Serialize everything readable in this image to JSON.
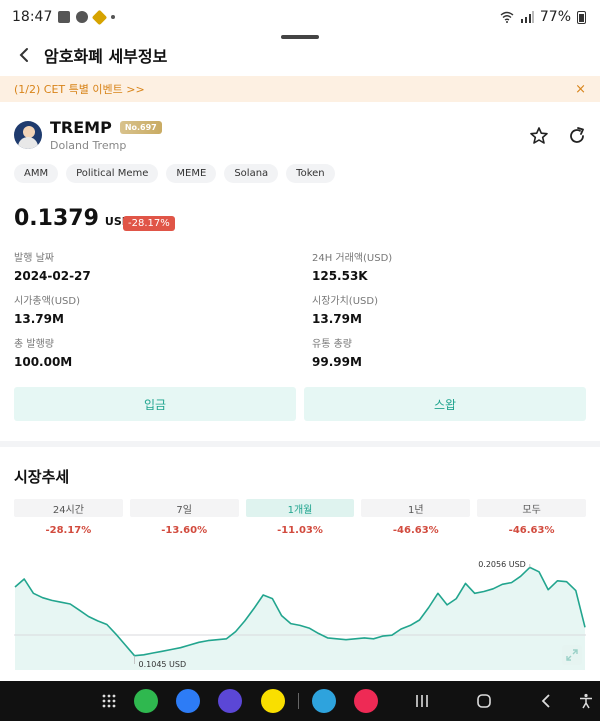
{
  "status_bar": {
    "time": "18:47",
    "battery": "77%"
  },
  "header": {
    "title": "암호화폐 세부정보"
  },
  "banner": {
    "text": "(1/2) CET 특별 이벤트 >>",
    "close": "×"
  },
  "coin": {
    "symbol": "TREMP",
    "rank": "No.697",
    "name": "Doland Tremp",
    "tags": [
      "AMM",
      "Political Meme",
      "MEME",
      "Solana",
      "Token"
    ]
  },
  "price": {
    "value": "0.1379",
    "unit": "USD",
    "change": "-28.17%"
  },
  "stats": [
    {
      "label": "발행 날짜",
      "value": "2024-02-27"
    },
    {
      "label": "24H 거래액(USD)",
      "value": "125.53K"
    },
    {
      "label": "시가총액(USD)",
      "value": "13.79M"
    },
    {
      "label": "시장가치(USD)",
      "value": "13.79M"
    },
    {
      "label": "총 발행량",
      "value": "100.00M"
    },
    {
      "label": "유통 총량",
      "value": "99.99M"
    }
  ],
  "actions": {
    "deposit": "입금",
    "swap": "스왑"
  },
  "market": {
    "title": "시장추세",
    "periods": [
      {
        "label": "24시간",
        "change": "-28.17%",
        "active": false
      },
      {
        "label": "7일",
        "change": "-13.60%",
        "active": false
      },
      {
        "label": "1개월",
        "change": "-11.03%",
        "active": true
      },
      {
        "label": "1년",
        "change": "-46.63%",
        "active": false
      },
      {
        "label": "모두",
        "change": "-46.63%",
        "active": false
      }
    ]
  },
  "chart_data": {
    "type": "area",
    "y": [
      0.183,
      0.192,
      0.176,
      0.171,
      0.168,
      0.166,
      0.164,
      0.157,
      0.15,
      0.145,
      0.141,
      0.13,
      0.118,
      0.106,
      0.107,
      0.109,
      0.111,
      0.113,
      0.115,
      0.118,
      0.121,
      0.123,
      0.124,
      0.125,
      0.133,
      0.145,
      0.159,
      0.174,
      0.17,
      0.151,
      0.142,
      0.14,
      0.137,
      0.131,
      0.126,
      0.125,
      0.124,
      0.125,
      0.126,
      0.125,
      0.128,
      0.129,
      0.136,
      0.14,
      0.146,
      0.16,
      0.176,
      0.163,
      0.17,
      0.187,
      0.176,
      0.178,
      0.181,
      0.186,
      0.188,
      0.195,
      0.205,
      0.2,
      0.18,
      0.19,
      0.189,
      0.179,
      0.1379
    ],
    "annotations": {
      "max_label": "0.2056 USD",
      "min_label": "0.1045 USD"
    },
    "ylim": [
      0.09,
      0.22
    ],
    "xlabel": "",
    "ylabel": "",
    "color": "#22a58e",
    "fill": "#e7f6f3"
  }
}
